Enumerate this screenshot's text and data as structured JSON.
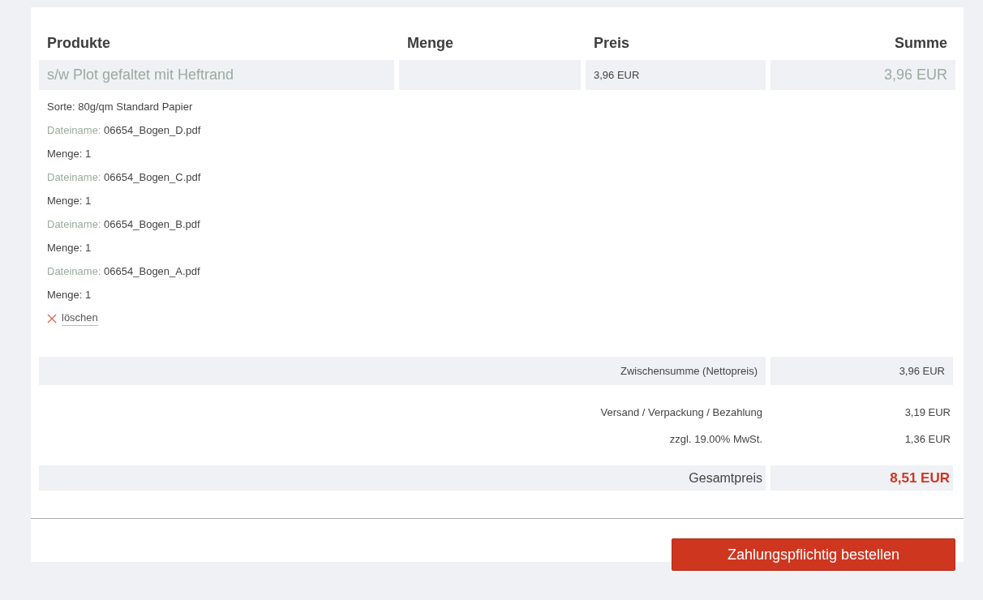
{
  "table": {
    "columns": [
      "Produkte",
      "Menge",
      "Preis",
      "Summe"
    ],
    "rows": [
      {
        "product": "s/w Plot gefaltet mit Heftrand",
        "price": "3,96 EUR",
        "sum": "3,96 EUR",
        "details": [
          {
            "kind": "text",
            "text": "Sorte: 80g/qm Standard Papier"
          },
          {
            "kind": "file",
            "label": "Dateiname:",
            "value": "06654_Bogen_D.pdf"
          },
          {
            "kind": "text",
            "text": "Menge: 1"
          },
          {
            "kind": "file",
            "label": "Dateiname:",
            "value": "06654_Bogen_C.pdf"
          },
          {
            "kind": "text",
            "text": "Menge: 1"
          },
          {
            "kind": "file",
            "label": "Dateiname:",
            "value": "06654_Bogen_B.pdf"
          },
          {
            "kind": "text",
            "text": "Menge: 1"
          },
          {
            "kind": "file",
            "label": "Dateiname:",
            "value": "06654_Bogen_A.pdf"
          },
          {
            "kind": "text",
            "text": "Menge: 1"
          }
        ],
        "delete_link": "löschen"
      }
    ]
  },
  "totals": [
    {
      "kind": "subtotal",
      "label": "Zwischensumme (Nettopreis)",
      "value": "3,96 EUR"
    },
    {
      "kind": "plain",
      "label": "Versand / Verpackung / Bezahlung",
      "value": "3,19 EUR"
    },
    {
      "kind": "plain",
      "label": "zzgl. 19.00% MwSt.",
      "value": "1,36 EUR"
    },
    {
      "kind": "total",
      "label": "Gesamtpreis",
      "value": "8,51 EUR"
    }
  ],
  "order_button": "Zahlungspflichtig bestellen"
}
